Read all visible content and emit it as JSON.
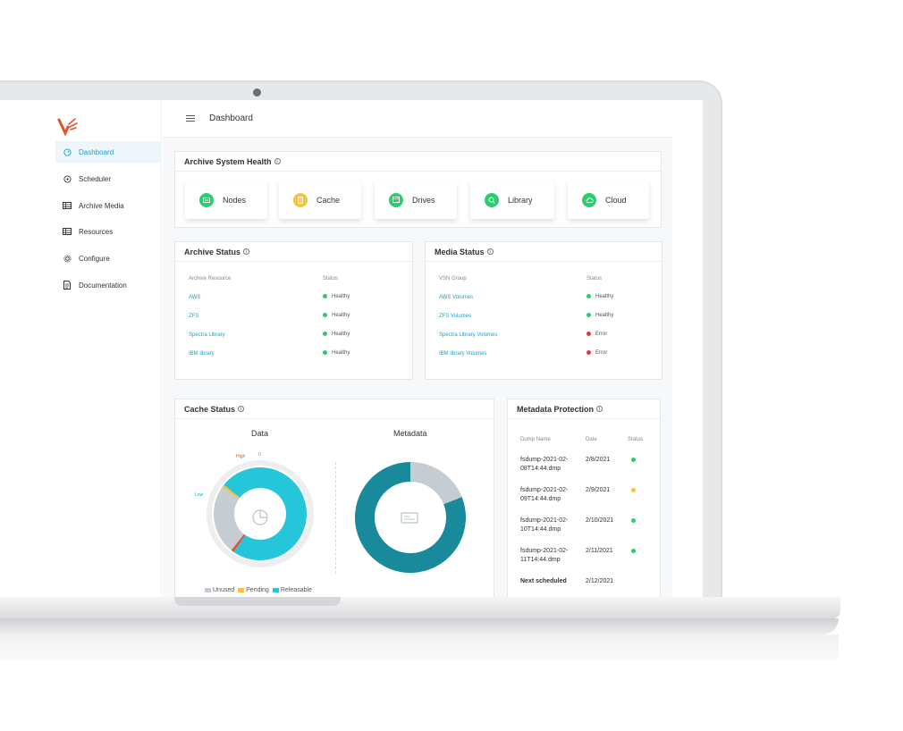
{
  "nav": {
    "items": [
      {
        "label": "Dashboard",
        "icon": "dashboard-icon",
        "active": true
      },
      {
        "label": "Scheduler",
        "icon": "clock-icon"
      },
      {
        "label": "Archive Media",
        "icon": "archive-icon"
      },
      {
        "label": "Resources",
        "icon": "resources-icon"
      },
      {
        "label": "Configure",
        "icon": "gear-icon"
      },
      {
        "label": "Documentation",
        "icon": "document-icon"
      }
    ]
  },
  "header": {
    "breadcrumb": "Dashboard"
  },
  "health": {
    "title": "Archive System Health",
    "items": [
      {
        "label": "Nodes",
        "color": "#2ecc71"
      },
      {
        "label": "Cache",
        "color": "#f5c242"
      },
      {
        "label": "Drives",
        "color": "#2ecc71"
      },
      {
        "label": "Library",
        "color": "#2ecc71"
      },
      {
        "label": "Cloud",
        "color": "#2ecc71"
      }
    ]
  },
  "archive_status": {
    "title": "Archive Status",
    "col_resource": "Archive Resource",
    "col_status": "Status",
    "rows": [
      {
        "name": "AWS",
        "status": "Healthy",
        "color": "#2ecc71"
      },
      {
        "name": "ZFS",
        "status": "Healthy",
        "color": "#2ecc71"
      },
      {
        "name": "Spectra Library",
        "status": "Healthy",
        "color": "#2ecc71"
      },
      {
        "name": "IBM library",
        "status": "Healthy",
        "color": "#2ecc71"
      }
    ]
  },
  "media_status": {
    "title": "Media Status",
    "col_group": "VSN Group",
    "col_status": "Status",
    "rows": [
      {
        "name": "AWS Volumes",
        "status": "Healthy",
        "color": "#2ecc71"
      },
      {
        "name": "ZFS Volumes",
        "status": "Healthy",
        "color": "#2ecc71"
      },
      {
        "name": "Spectra Library Volumes",
        "status": "Error",
        "color": "#e53935"
      },
      {
        "name": "IBM library Volumes",
        "status": "Error",
        "color": "#e53935"
      }
    ]
  },
  "cache_status": {
    "title": "Cache Status",
    "data_title": "Data",
    "metadata_title": "Metadata",
    "label_high": "High",
    "label_low": "Low",
    "label_zero": "0",
    "legend": [
      {
        "label": "Unused",
        "color": "#c5cdd3"
      },
      {
        "label": "Pending",
        "color": "#f5c242"
      },
      {
        "label": "Releasable",
        "color": "#26c6da"
      }
    ]
  },
  "chart_data": [
    {
      "type": "pie",
      "title": "Data",
      "categories": [
        "Unused",
        "Pending",
        "Releasable",
        "High"
      ],
      "values": [
        24,
        1,
        74,
        1
      ],
      "colors": [
        "#c5cdd3",
        "#f5c242",
        "#26c6da",
        "#e0552b"
      ]
    },
    {
      "type": "pie",
      "title": "Metadata",
      "categories": [
        "Unused",
        "Used"
      ],
      "values": [
        19,
        81
      ],
      "colors": [
        "#c5cdd3",
        "#188a9b"
      ]
    }
  ],
  "metadata_protection": {
    "title": "Metadata Protection",
    "col_name": "Dump Name",
    "col_date": "Date",
    "col_status": "Status",
    "rows": [
      {
        "name_l1": "fsdump-2021-02-",
        "name_l2": "08T14:44.dmp",
        "date": "2/8/2021",
        "color": "#2ecc71"
      },
      {
        "name_l1": "fsdump-2021-02-",
        "name_l2": "09T14:44.dmp",
        "date": "2/9/2021",
        "color": "#f5c242"
      },
      {
        "name_l1": "fsdump-2021-02-",
        "name_l2": "10T14:44.dmp",
        "date": "2/10/2021",
        "color": "#2ecc71"
      },
      {
        "name_l1": "fsdump-2021-02-",
        "name_l2": "11T14:44.dmp",
        "date": "2/11/2021",
        "color": "#2ecc71"
      }
    ],
    "next_label": "Next scheduled",
    "next_date": "2/12/2021"
  }
}
